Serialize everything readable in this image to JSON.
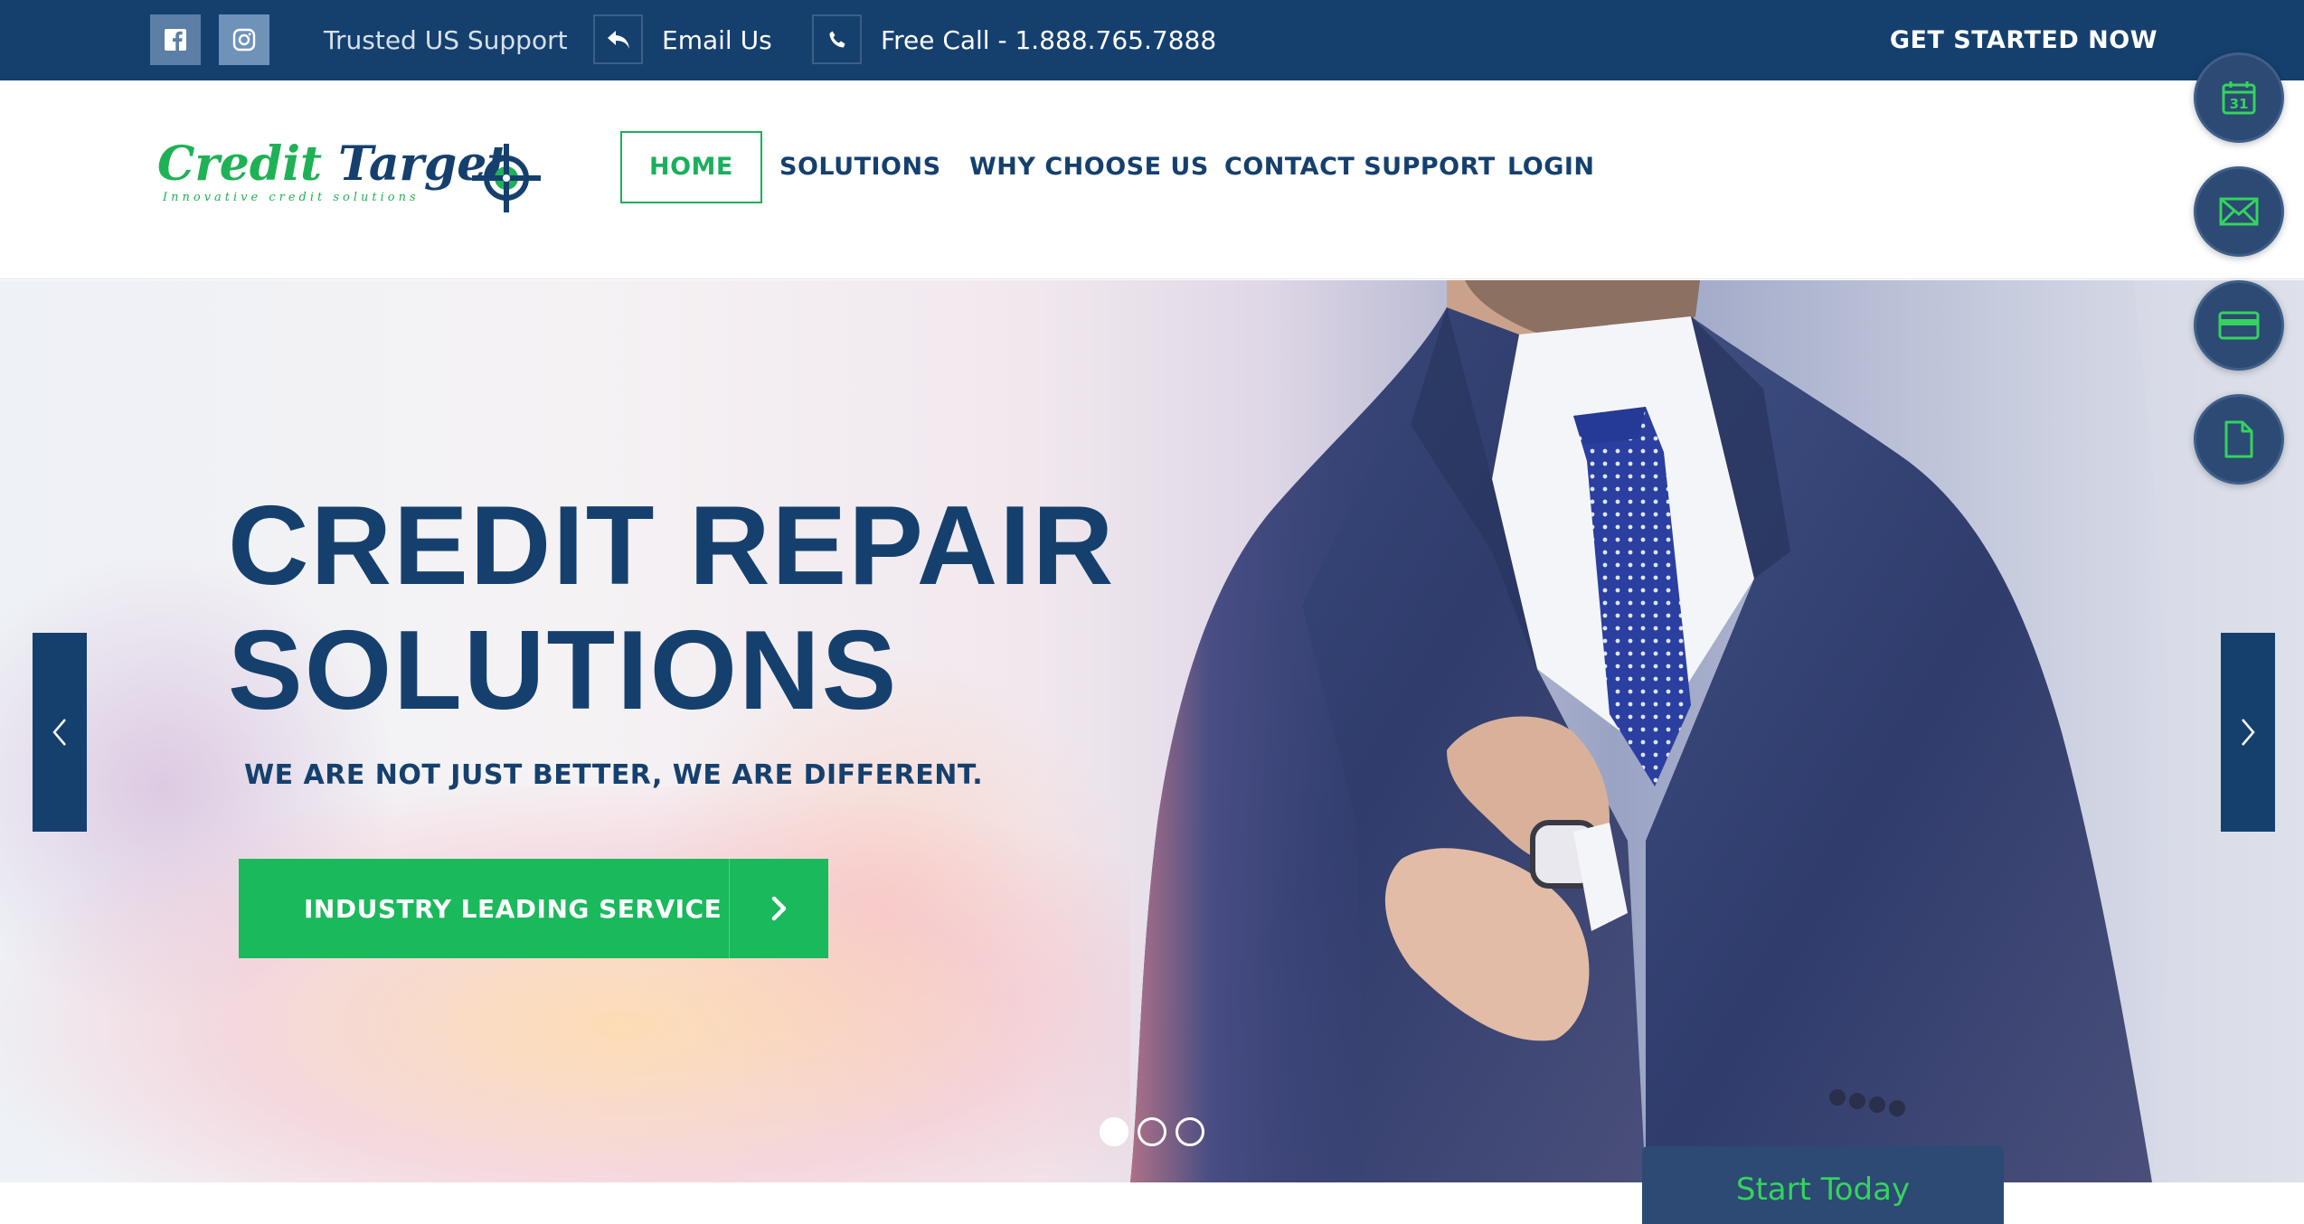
{
  "topbar": {
    "trusted_text": "Trusted US Support",
    "email_label": "Email Us",
    "call_label": "Free Call - 1.888.765.7888",
    "get_started": "GET STARTED NOW"
  },
  "logo": {
    "word1": "Credit",
    "word2": "Target",
    "tagline": "Innovative credit solutions"
  },
  "nav": {
    "items": [
      {
        "label": "HOME",
        "active": true
      },
      {
        "label": "SOLUTIONS",
        "active": false
      },
      {
        "label": "WHY CHOOSE US",
        "active": false
      },
      {
        "label": "CONTACT SUPPORT",
        "active": false
      },
      {
        "label": "LOGIN",
        "active": false
      }
    ]
  },
  "hero": {
    "title_line1": "CREDIT REPAIR",
    "title_line2": "SOLUTIONS",
    "subtitle": "WE ARE NOT JUST BETTER, WE ARE DIFFERENT.",
    "cta_label": "INDUSTRY LEADING SERVICE",
    "slides_count": 3,
    "active_slide": 1
  },
  "side_buttons": {
    "calendar_number": "31",
    "icons": [
      "calendar-icon",
      "mail-icon",
      "credit-card-icon",
      "document-icon"
    ]
  },
  "start_tab": {
    "label": "Start Today"
  },
  "colors": {
    "navy": "#15406e",
    "green": "#1ab95c",
    "side_button": "#2c4a73",
    "side_icon": "#35d35e"
  }
}
